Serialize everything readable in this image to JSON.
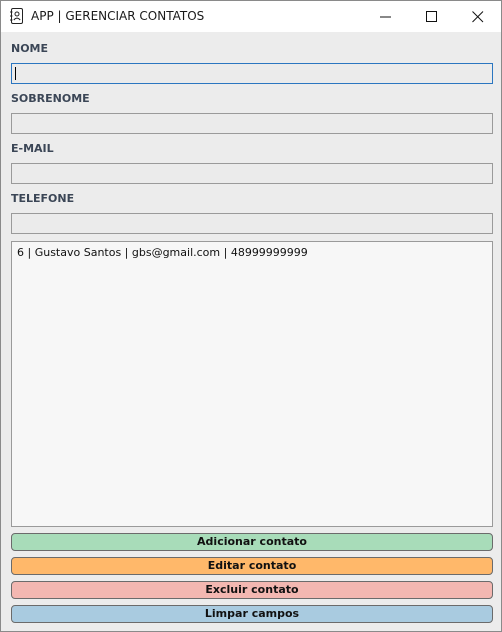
{
  "window": {
    "title": "APP | GERENCIAR CONTATOS",
    "icon": "contact-book-icon",
    "controls": [
      "minimize-icon",
      "maximize-icon",
      "close-icon"
    ]
  },
  "form": {
    "nome": {
      "label": "NOME",
      "value": ""
    },
    "sobrenome": {
      "label": "SOBRENOME",
      "value": ""
    },
    "email": {
      "label": "E-MAIL",
      "value": ""
    },
    "telefone": {
      "label": "TELEFONE",
      "value": ""
    }
  },
  "contacts": [
    "6 | Gustavo Santos | gbs@gmail.com | 48999999999"
  ],
  "buttons": {
    "add": {
      "label": "Adicionar contato",
      "color": "#a8dcb9"
    },
    "edit": {
      "label": "Editar contato",
      "color": "#ffb86a"
    },
    "delete": {
      "label": "Excluir contato",
      "color": "#f3b7b1"
    },
    "clear": {
      "label": "Limpar campos",
      "color": "#a9cbe0"
    }
  }
}
